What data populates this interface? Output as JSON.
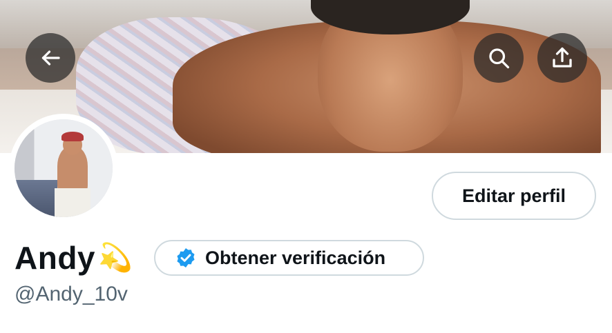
{
  "header": {
    "back_icon": "arrow-left-icon",
    "search_icon": "search-icon",
    "share_icon": "share-upload-icon",
    "button_background": "#282828"
  },
  "profile": {
    "edit_label": "Editar perfil",
    "display_name": "Andy",
    "name_emoji": "💫",
    "verify_label": "Obtener verificación",
    "verify_badge_color": "#1d9bf0",
    "handle": "@Andy_10v"
  },
  "colors": {
    "text_primary": "#0f1419",
    "text_secondary": "#536471",
    "border": "#cfd9de"
  }
}
